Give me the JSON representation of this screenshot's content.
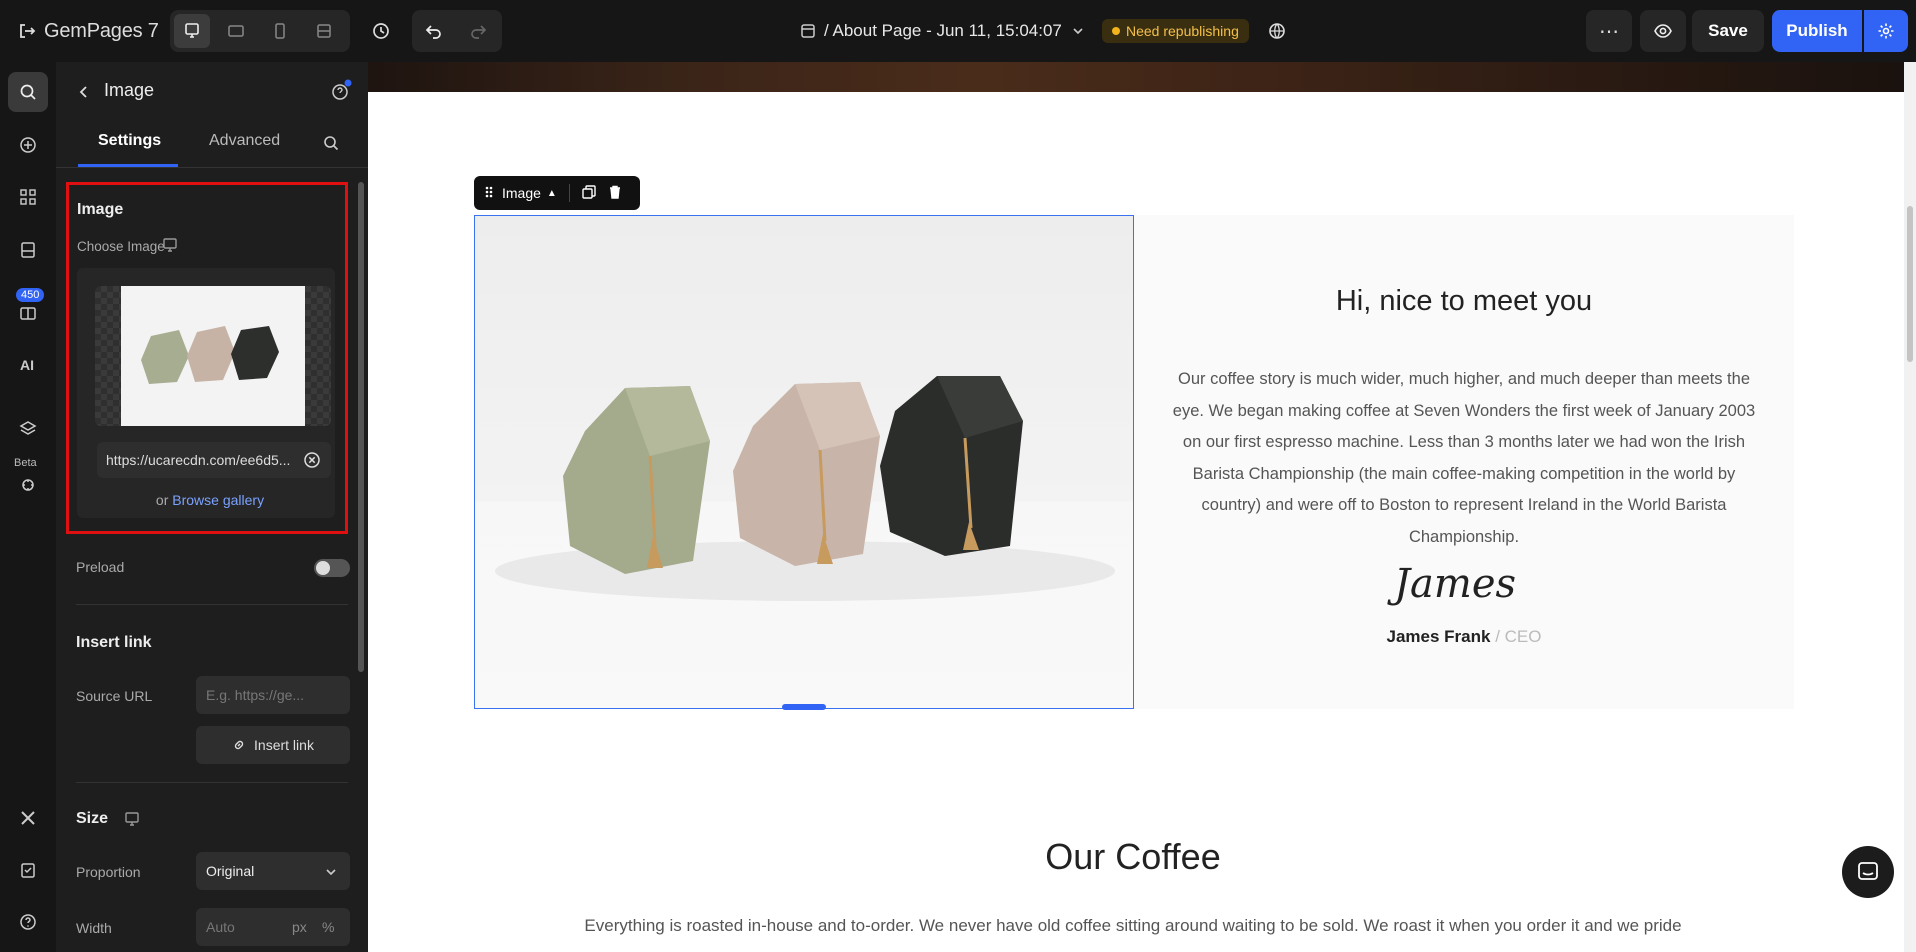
{
  "header": {
    "brand": "GemPages 7",
    "page_title": "/ About Page - Jun 11, 15:04:07",
    "status_badge": "Need republishing",
    "save_label": "Save",
    "publish_label": "Publish"
  },
  "rail": {
    "library_count": "450",
    "beta_label": "Beta"
  },
  "panel": {
    "title": "Image",
    "tabs": [
      "Settings",
      "Advanced"
    ],
    "image_section": {
      "title": "Image",
      "choose_label": "Choose Image",
      "url_value": "https://ucarecdn.com/ee6d5...",
      "browse_prefix": "or",
      "browse_link": "Browse gallery"
    },
    "preload_label": "Preload",
    "preload_on": false,
    "insert_link": {
      "title": "Insert link",
      "source_label": "Source URL",
      "source_placeholder": "E.g. https://ge...",
      "button": "Insert link"
    },
    "size": {
      "title": "Size",
      "proportion_label": "Proportion",
      "proportion_value": "Original",
      "width_label": "Width",
      "width_placeholder": "Auto",
      "unit_px": "px",
      "unit_pct": "%"
    }
  },
  "canvas": {
    "toolbar_label": "Image",
    "heading": "Hi, nice to meet you",
    "story": "Our coffee story is much wider, much higher, and much deeper than meets the eye. We began making coffee at Seven Wonders the first week of January 2003 on our first espresso machine. Less than 3 months later we had won the Irish Barista Championship (the main coffee-making competition in the world by country) and were off to Boston to represent Ireland in the World Barista Championship.",
    "signature_text": "James",
    "author_name": "James Frank",
    "author_sep": " / ",
    "author_role": "CEO",
    "section_title": "Our Coffee",
    "section_text": "Everything is roasted in-house and to-order. We never have old coffee sitting around waiting to be sold. We roast it when you order it and we pride"
  },
  "colors": {
    "accent": "#3163f5",
    "highlight_border": "#e01010",
    "badge_text": "#f3c04a"
  }
}
